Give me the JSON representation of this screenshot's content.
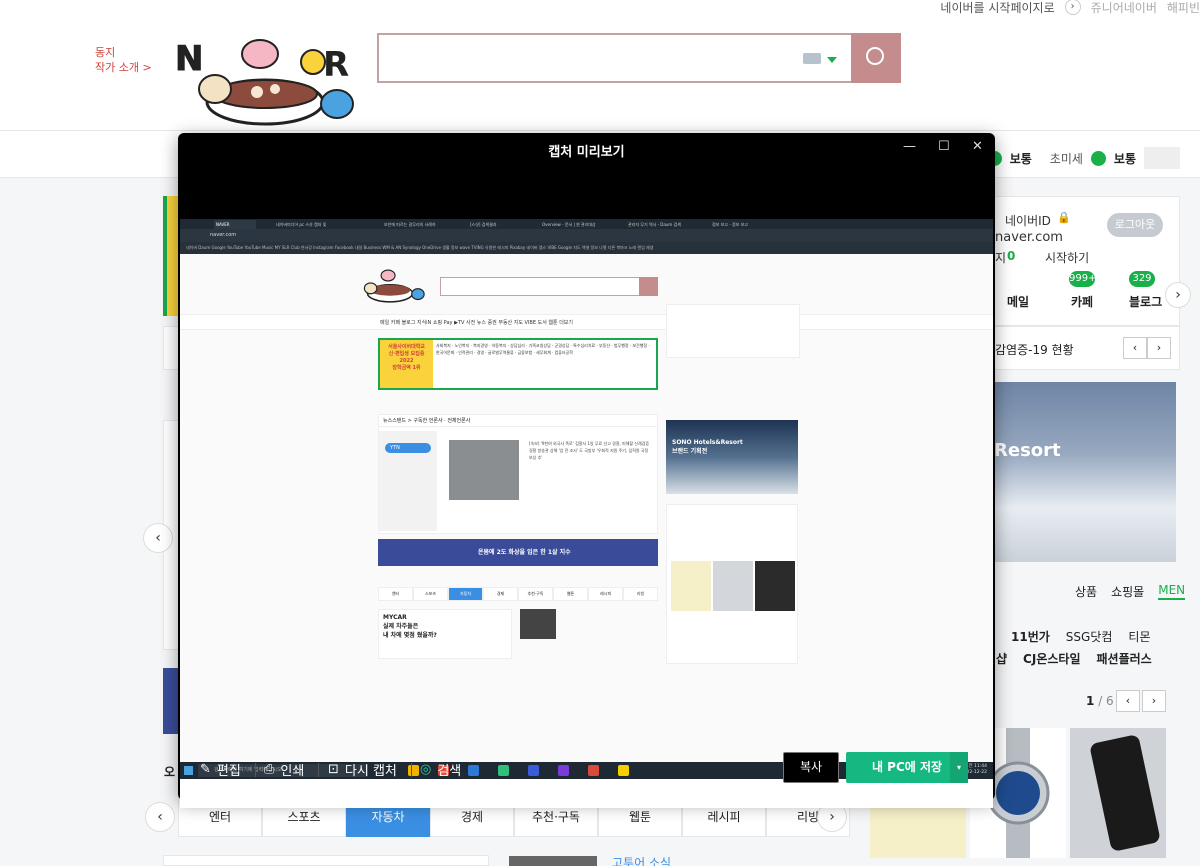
{
  "background_page": {
    "top_links": {
      "set_home": "네이버를 시작페이지로",
      "junior_naver": "쥬니어네이버",
      "happybean": "해피빈"
    },
    "author_link": {
      "line1": "동지",
      "line2": "작가 소개 >"
    },
    "weather": {
      "status1": "보통",
      "fine_dust_label": "초미세",
      "status2": "보통"
    },
    "account": {
      "id_label": "네이버ID",
      "logout_button": "로그아웃",
      "domain": "naver.com",
      "count_label": "지",
      "count_value": "0",
      "start_label": "시작하기"
    },
    "quick_tabs": [
      {
        "label": "메일"
      },
      {
        "label": "카페",
        "badge": "999+"
      },
      {
        "label": "블로그",
        "badge": "329"
      }
    ],
    "covid_text": "감염증-19 현황",
    "resort_text": "Resort",
    "shop_tabs": [
      "상품",
      "쇼핑몰",
      "MEN"
    ],
    "shop_line1": [
      "11번가",
      "SSG닷컴",
      "티몬"
    ],
    "shop_line2": [
      "샵",
      "CJ온스타일",
      "패션플러스"
    ],
    "shop_page": "1",
    "shop_page_total": "/ 6",
    "category_tabs": [
      "엔터",
      "스포츠",
      "자동차",
      "경제",
      "추천·구독",
      "웹툰",
      "레시피",
      "리빙"
    ],
    "active_category": 2,
    "left_fragment": "오",
    "news_fragment": "고투어 소식"
  },
  "dialog": {
    "title": "캡처 미리보기",
    "window_controls": [
      "—",
      "☐",
      "✕"
    ],
    "tools": [
      {
        "label": "편집",
        "icon": "edit-icon"
      },
      {
        "label": "인쇄",
        "icon": "print-icon"
      },
      {
        "label": "다시 캡처",
        "icon": "capture-icon"
      },
      {
        "label": "검색",
        "icon": "search-lens-icon"
      }
    ],
    "copy_button": "복사",
    "save_button": "내 PC에 저장",
    "save_dropdown": "▾"
  },
  "captured_screen": {
    "tabs": [
      "NAVER",
      "네이버미디어 pc 스샷 캡처 및",
      "보안에 따르는 갈무리의 사례하",
      "[스샷] 검색결과",
      "Overview - 문서 | 윈 관리대상",
      "관리자 무기 역사 - Daum 검색",
      "정보 보고 - 정보 보고"
    ],
    "url": "naver.com",
    "bookmarks": "네이버  Daum  Google  YouTube  YouTube Music  MY  SLR Club  연서강  Instagram  Facebook  내일   Business  WM & AN  Synology  OneDrive  생활 정보  wave  TVING  유명한 레시피  Pixabay  네이버 랩스  VIBE  Google 지도  엑셀 정보 나열  다른 북마크  노래 랜덤 재생",
    "nav": "메일  카페  블로그  지식iN  쇼핑  Pay  ▶TV  사전  뉴스  증권  부동산  지도  VIBE  도서  웹툰  더보기",
    "banner_left": "서울사이버대학교\n신·편입생 모집중\n2022\n장학금액 1위",
    "banner_right": "사회복지 · 노인복지 · 복지경영 · 아동복지 · 상담심리 · 가족코칭상담 · 군경상담 · 특수심리치료 · 부동산 · 법무행정 · 보건행정 · 한국어문화 · 인적관리 · 경영 · 글로벌무역물류 · 금융보험 · 세무회계 · 컴퓨터공학",
    "news_header": "뉴스스탠드 > 구독한 언론사 · 전체언론사",
    "news_channel": "YTN",
    "news_text": "[속보] '9천여 외국사 폭로' 검찰서 1일 무료 선고 경찰, 피해할 신례검증 경찰 방송관 상해 '업 전 조사' 도 국방부 '우회적 지원 주기, 임직원 국정보상 추'",
    "ad_text": "온몸에 2도 화상을 입은 한 1살 지수",
    "category_tabs": [
      "엔터",
      "스포츠",
      "자동차",
      "경제",
      "추천·구독",
      "웹툰",
      "레시피",
      "리빙"
    ],
    "car_text": "MYCAR\n실제 차주들은\n내 차에 몇점 줬을까?",
    "resort_text": "SONO Hotels&Resort\n브랜드 기획전",
    "taskbar_search": "검색하려면 여기에 입력하십시오.",
    "clock_time": "오전 11:44",
    "clock_date": "2022-12-22"
  },
  "colors": {
    "naver_green": "#19b04a",
    "search_border": "#c2a3a3",
    "search_button": "#c48c8c",
    "save_green": "#16b881",
    "active_tab_blue": "#3b8fe3"
  }
}
